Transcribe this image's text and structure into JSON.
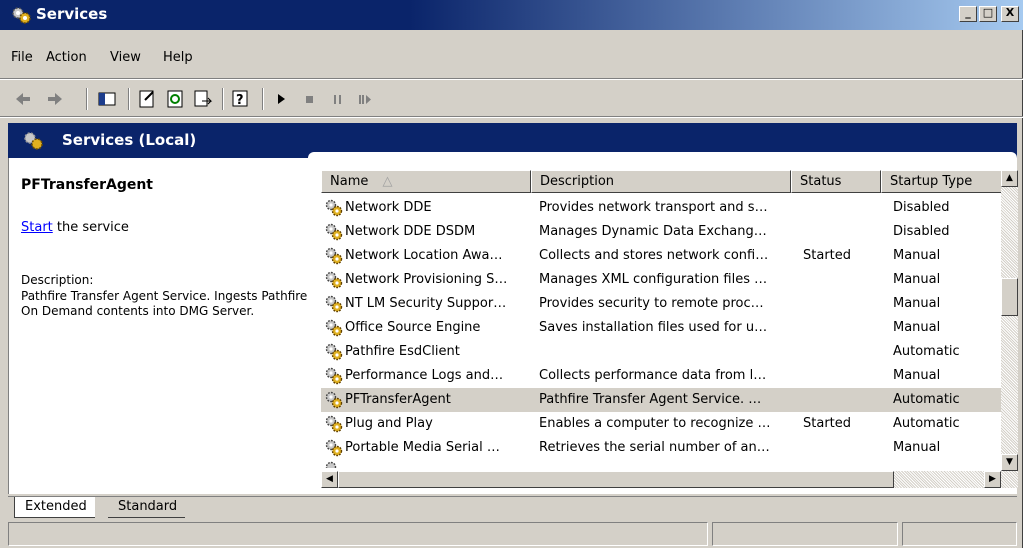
{
  "window": {
    "title": "Services"
  },
  "menu": [
    "File",
    "Action",
    "View",
    "Help"
  ],
  "toolbar": {
    "buttons": [
      "back-icon",
      "forward-icon",
      "show-hide-tree-icon",
      "properties-icon",
      "refresh-icon",
      "export-list-icon",
      "help-icon",
      "start-icon",
      "stop-icon",
      "pause-icon",
      "restart-icon"
    ]
  },
  "banner": {
    "title": "Services (Local)"
  },
  "left_pane": {
    "service_name": "PFTransferAgent",
    "start_link": "Start",
    "start_suffix": " the service",
    "description_label": "Description:",
    "description": "Pathfire Transfer Agent Service. Ingests Pathfire On Demand contents into DMG Server."
  },
  "columns": [
    "Name",
    "Description",
    "Status",
    "Startup Type"
  ],
  "sort_indicator": "△",
  "rows": [
    {
      "name": "Network DDE",
      "description": "Provides network transport and s…",
      "status": "",
      "startup": "Disabled"
    },
    {
      "name": "Network DDE DSDM",
      "description": "Manages Dynamic Data Exchang…",
      "status": "",
      "startup": "Disabled"
    },
    {
      "name": "Network Location Awa…",
      "description": "Collects and stores network confi…",
      "status": "Started",
      "startup": "Manual"
    },
    {
      "name": "Network Provisioning S…",
      "description": "Manages XML configuration files …",
      "status": "",
      "startup": "Manual"
    },
    {
      "name": "NT LM Security Suppor…",
      "description": "Provides security to remote proc…",
      "status": "",
      "startup": "Manual"
    },
    {
      "name": "Office Source Engine",
      "description": "Saves installation files used for u…",
      "status": "",
      "startup": "Manual"
    },
    {
      "name": "Pathfire EsdClient",
      "description": "",
      "status": "",
      "startup": "Automatic"
    },
    {
      "name": "Performance Logs and…",
      "description": "Collects performance data from l…",
      "status": "",
      "startup": "Manual"
    },
    {
      "name": "PFTransferAgent",
      "description": "Pathfire Transfer Agent Service. …",
      "status": "",
      "startup": "Automatic"
    },
    {
      "name": "Plug and Play",
      "description": "Enables a computer to recognize …",
      "status": "Started",
      "startup": "Automatic"
    },
    {
      "name": "Portable Media Serial …",
      "description": "Retrieves the serial number of an…",
      "status": "",
      "startup": "Manual"
    }
  ],
  "selected_row": 8,
  "tabs": [
    "Extended",
    "Standard"
  ],
  "window_buttons": {
    "minimize": "_",
    "maximize": "□",
    "close": "X"
  }
}
